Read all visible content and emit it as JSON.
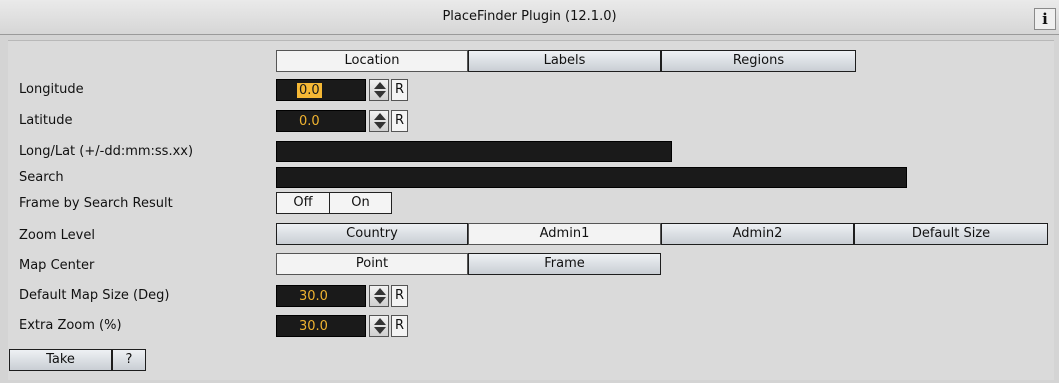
{
  "window": {
    "title": "PlaceFinder Plugin (12.1.0)",
    "info_label": "i"
  },
  "tabs": [
    {
      "label": "Location",
      "active": true
    },
    {
      "label": "Labels",
      "active": false
    },
    {
      "label": "Regions",
      "active": false
    }
  ],
  "fields": {
    "longitude": {
      "label": "Longitude",
      "value": "0.0",
      "reset": "R"
    },
    "latitude": {
      "label": "Latitude",
      "value": "0.0",
      "reset": "R"
    },
    "longlat": {
      "label": "Long/Lat (+/-dd:mm:ss.xx)",
      "value": ""
    },
    "search": {
      "label": "Search",
      "value": ""
    },
    "frame_by_search": {
      "label": "Frame by Search Result",
      "off": "Off",
      "on": "On",
      "selected": "Off"
    },
    "zoom_level": {
      "label": "Zoom Level",
      "options": [
        "Country",
        "Admin1",
        "Admin2",
        "Default Size"
      ],
      "selected": "Admin1"
    },
    "map_center": {
      "label": "Map Center",
      "options": [
        "Point",
        "Frame"
      ],
      "selected": "Point"
    },
    "default_map_size": {
      "label": "Default Map Size (Deg)",
      "value": "30.0",
      "reset": "R"
    },
    "extra_zoom": {
      "label": "Extra Zoom (%)",
      "value": "30.0",
      "reset": "R"
    }
  },
  "actions": {
    "take": "Take",
    "help": "?"
  },
  "colors": {
    "field_bg": "#1a1a1a",
    "value_text": "#f0b330",
    "selection": "#f5b835"
  }
}
